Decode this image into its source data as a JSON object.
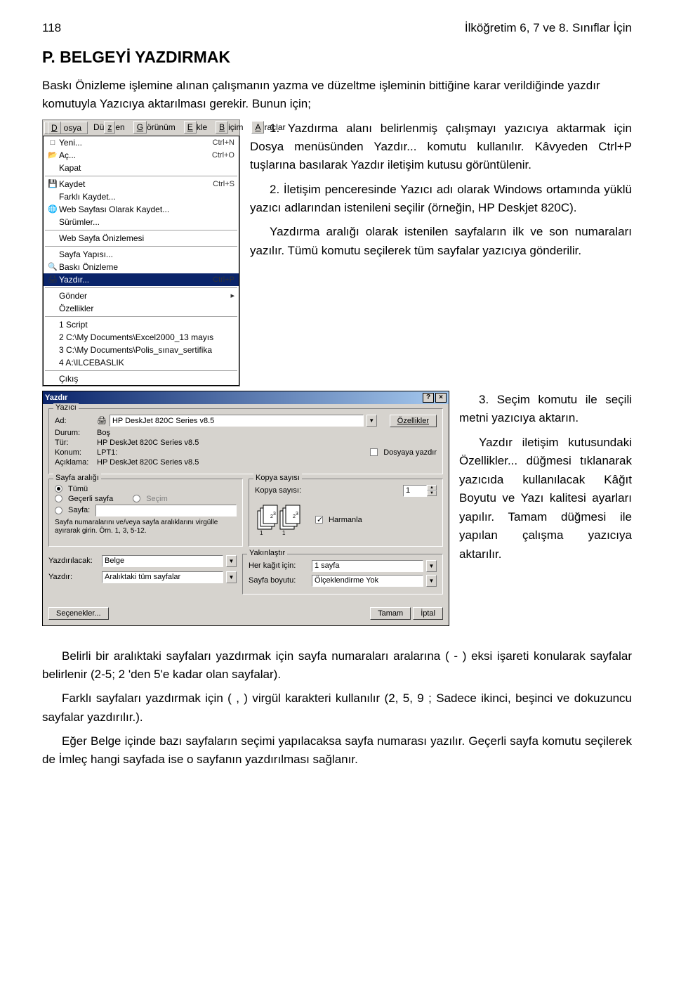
{
  "header": {
    "page_no": "118",
    "title": "İlköğretim 6, 7 ve 8. Sınıflar İçin"
  },
  "section_title": "P. BELGEYİ YAZDIRMAK",
  "intro": "Baskı Önizleme işlemine alınan çalışmanın yazma ve düzeltme işleminin bittiğine karar verildiğinde yazdır komutuyla Yazıcıya aktarılması gerekir. Bunun için;",
  "steps": {
    "s1": "1. Yazdırma alanı belirlenmiş çalışmayı yazıcıya aktarmak için Dosya menüsünden Yazdır... komutu kullanılır. Kâvyeden Ctrl+P tuşlarına basılarak Yazdır iletişim kutusu görüntülenir.",
    "s2": "2. İletişim penceresinde Yazıcı adı olarak Windows ortamında yüklü yazıcı adlarından istenileni seçilir (örneğin, HP Deskjet 820C).",
    "s2b": "Yazdırma aralığı olarak istenilen sayfaların ilk ve son numaraları yazılır. Tümü komutu seçilerek tüm sayfalar yazıcıya gönderilir.",
    "s3": "3. Seçim komutu ile seçili metni yazıcıya aktarın.",
    "s4a": "Yazdır iletişim kutusundaki Özellikler... düğmesi tıklanarak yazıcıda kullanılacak Kâğıt Boyutu ve Yazı kalitesi ayarları yapılır. Tamam düğmesi ile yapılan çalışma yazıcıya aktarılır."
  },
  "menu": {
    "menubar": [
      "Dosya",
      "Düzen",
      "Görünüm",
      "Ekle",
      "Biçim",
      "Araçlar"
    ],
    "items": [
      {
        "icon": "□",
        "label": "Yeni...",
        "sc": "Ctrl+N"
      },
      {
        "icon": "📂",
        "label": "Aç...",
        "sc": "Ctrl+O"
      },
      {
        "icon": "",
        "label": "Kapat",
        "sc": ""
      },
      {
        "div": true
      },
      {
        "icon": "💾",
        "label": "Kaydet",
        "sc": "Ctrl+S"
      },
      {
        "icon": "",
        "label": "Farklı Kaydet...",
        "sc": ""
      },
      {
        "icon": "🌐",
        "label": "Web Sayfası Olarak Kaydet...",
        "sc": ""
      },
      {
        "icon": "",
        "label": "Sürümler...",
        "sc": ""
      },
      {
        "div": true
      },
      {
        "icon": "",
        "label": "Web Sayfa Önizlemesi",
        "sc": ""
      },
      {
        "div": true
      },
      {
        "icon": "",
        "label": "Sayfa Yapısı...",
        "sc": ""
      },
      {
        "icon": "🔍",
        "label": "Baskı Önizleme",
        "sc": ""
      },
      {
        "icon": "🖨",
        "label": "Yazdır...",
        "sc": "Ctrl+P",
        "sel": true
      },
      {
        "div": true
      },
      {
        "icon": "",
        "label": "Gönder",
        "sc": "▸"
      },
      {
        "icon": "",
        "label": "Özellikler",
        "sc": ""
      },
      {
        "div": true
      },
      {
        "icon": "",
        "label": "1 Script",
        "sc": ""
      },
      {
        "icon": "",
        "label": "2 C:\\My Documents\\Excel2000_13 mayıs",
        "sc": ""
      },
      {
        "icon": "",
        "label": "3 C:\\My Documents\\Polis_sınav_sertifika",
        "sc": ""
      },
      {
        "icon": "",
        "label": "4 A:\\ILCEBASLIK",
        "sc": ""
      },
      {
        "div": true
      },
      {
        "icon": "",
        "label": "Çıkış",
        "sc": ""
      }
    ]
  },
  "dlg": {
    "title": "Yazdır",
    "printer_legend": "Yazıcı",
    "ad_lab": "Ad:",
    "ad_val": "HP DeskJet 820C Series v8.5",
    "props_btn": "Özellikler",
    "durum_lab": "Durum:",
    "durum_val": "Boş",
    "tur_lab": "Tür:",
    "tur_val": "HP DeskJet 820C Series v8.5",
    "konum_lab": "Konum:",
    "konum_val": "LPT1:",
    "acik_lab": "Açıklama:",
    "acik_val": "HP DeskJet 820C Series v8.5",
    "dosyaya": "Dosyaya yazdır",
    "range_legend": "Sayfa aralığı",
    "r_tumu": "Tümü",
    "r_gecerli": "Geçerli sayfa",
    "r_secim": "Seçim",
    "r_sayfa": "Sayfa:",
    "range_help": "Sayfa numaralarını ve/veya sayfa aralıklarını virgülle ayırarak girin. Örn. 1, 3, 5-12.",
    "copy_legend": "Kopya sayısı",
    "copy_lab": "Kopya sayısı:",
    "copy_val": "1",
    "harmanla": "Harmanla",
    "yazdirilacak_lab": "Yazdırılacak:",
    "yazdirilacak_val": "Belge",
    "yazdir_lab": "Yazdır:",
    "yazdir_val": "Aralıktaki tüm sayfalar",
    "zoom_legend": "Yakınlaştır",
    "kagit_lab": "Her kağıt için:",
    "kagit_val": "1 sayfa",
    "boyut_lab": "Sayfa boyutu:",
    "boyut_val": "Ölçeklendirme Yok",
    "secenekler": "Seçenekler...",
    "tamam": "Tamam",
    "iptal": "İptal"
  },
  "bottom": {
    "p1": "Belirli bir aralıktaki sayfaları yazdırmak için sayfa numaraları aralarına ( - ) eksi işareti konularak sayfalar belirlenir (2-5; 2 'den 5'e kadar olan sayfalar).",
    "p2": "Farklı sayfaları yazdırmak için ( , ) virgül karakteri kullanılır (2, 5, 9 ; Sadece ikinci, beşinci ve dokuzuncu sayfalar yazdırılır.).",
    "p3": "Eğer Belge içinde bazı sayfaların seçimi yapılacaksa sayfa numarası yazılır. Geçerli sayfa komutu seçilerek de İmleç hangi sayfada ise o sayfanın yazdırılması sağlanır."
  }
}
